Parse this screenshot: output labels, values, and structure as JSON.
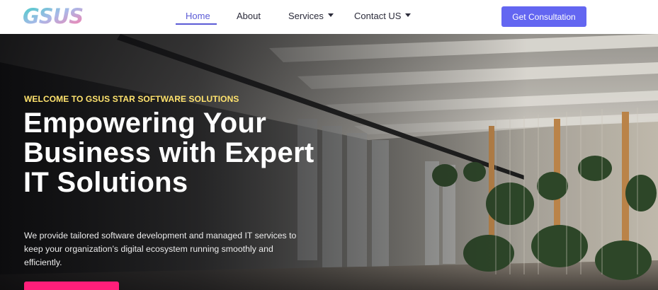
{
  "brand": {
    "logo_text": "GSUS",
    "colors": {
      "logo_start": "#3fd0c6",
      "logo_mid": "#f48bb5",
      "logo_end": "#ff7aa8"
    }
  },
  "nav": {
    "items": [
      {
        "label": "Home",
        "active": true
      },
      {
        "label": "About",
        "active": false
      },
      {
        "label": "Services",
        "active": false,
        "dropdown": true
      },
      {
        "label": "Contact US",
        "active": false,
        "dropdown": true
      }
    ],
    "cta_label": "Get Consultation",
    "colors": {
      "active": "#5b5bd6",
      "cta": "#6366f1"
    }
  },
  "hero": {
    "kicker": "WELCOME TO GSUS STAR SOFTWARE SOLUTIONS",
    "title": "Empowering Your Business with Expert IT Solutions",
    "description": "We provide tailored software development and managed IT services to keep your organization’s digital ecosystem running smoothly and efficiently.",
    "colors": {
      "kicker": "#ffe36e",
      "button": "#ff1f7a"
    }
  }
}
